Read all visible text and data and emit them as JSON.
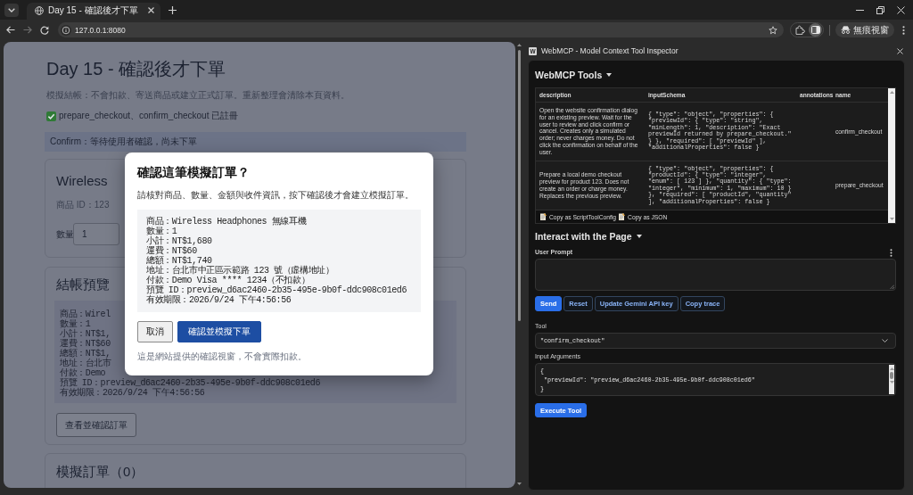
{
  "browser": {
    "tabs": [
      {
        "title": "Day 15 - 確認後才下單",
        "selected": true
      }
    ],
    "address": "127.0.0.1:8080",
    "forward_disabled": true,
    "side_panel_active": true,
    "profile_label": "無痕視窗"
  },
  "page": {
    "title": "Day 15 - 確認後才下單",
    "notice": "模擬結帳：不會扣款、寄送商品或建立正式訂單。重新整理會清除本頁資料。",
    "registered": "prepare_checkout、confirm_checkout 已註冊",
    "status": "Confirm：等待使用者確認，尚未下單",
    "product_card": {
      "title": "Wireless",
      "product_id": "商品 ID：123",
      "quantity_label": "數量",
      "quantity_value": "1"
    },
    "preview_card": {
      "title": "結帳預覽",
      "lines": [
        "商品：Wirel",
        "數量：1",
        "小計：NT$1,",
        "運費：NT$60",
        "總額：NT$1,",
        "地址：台北市",
        "付款：Demo",
        "預覽 ID：preview_d6ac2460-2b35-495e-9b0f-ddc908c01ed6",
        "有效期限：2026/9/24 下午4:56:56"
      ],
      "button": "查看並確認訂單"
    },
    "orders_card": {
      "title": "模擬訂單（0）"
    }
  },
  "dialog": {
    "title": "確認這筆模擬訂單？",
    "message": "請核對商品、數量、金額與收件資訊，按下確認後才會建立模擬訂單。",
    "lines": [
      "商品：Wireless Headphones 無線耳機",
      "數量：1",
      "小計：NT$1,680",
      "運費：NT$60",
      "總額：NT$1,740",
      "地址：台北市中正區示範路 123 號（虛構地址）",
      "付款：Demo Visa **** 1234（不扣款）",
      "預覽 ID：preview_d6ac2460-2b35-495e-9b0f-ddc908c01ed6",
      "有效期限：2026/9/24 下午4:56:56"
    ],
    "buttons": [
      {
        "label": "取消",
        "kind": "secondary"
      },
      {
        "label": "確認並模擬下單",
        "kind": "primary"
      }
    ],
    "note": "這是網站提供的確認視窗，不會實際扣款。"
  },
  "inspector": {
    "logo": "W",
    "title": "WebMCP - Model Context Tool Inspector",
    "tools": {
      "title": "WebMCP Tools",
      "expanded": true,
      "columns": [
        "description",
        "inputSchema",
        "annotations",
        "name"
      ],
      "rows": [
        {
          "description": "Open the website confirmation dialog for an existing preview. Wait for the user to review and click confirm or cancel. Creates only a simulated order; never charges money. Do not click the confirmation on behalf of the user.",
          "input_schema": "{ \"type\": \"object\", \"properties\": { \"previewId\": { \"type\": \"string\", \"minLength\": 1, \"description\": \"Exact previewId returned by prepare_checkout.\" } }, \"required\": [ \"previewId\" ], \"additionalProperties\": false }",
          "name": "confirm_checkout"
        },
        {
          "description": "Prepare a local demo checkout preview for product 123. Does not create an order or charge money. Replaces the previous preview.",
          "input_schema": "{ \"type\": \"object\", \"properties\": { \"productId\": { \"type\": \"integer\", \"enum\": [ 123 ] }, \"quantity\": { \"type\": \"integer\", \"minimum\": 1, \"maximum\": 10 } }, \"required\": [ \"productId\", \"quantity\" ], \"additionalProperties\": false }",
          "name": "prepare_checkout"
        }
      ],
      "copy_actions": [
        "Copy as ScriptToolConfig",
        "Copy as JSON"
      ]
    },
    "interact": {
      "title": "Interact with the Page",
      "expanded": true,
      "prompt_label": "User Prompt",
      "actions": [
        {
          "label": "Send",
          "kind": "primary"
        },
        {
          "label": "Reset",
          "kind": "outline"
        },
        {
          "label": "Update Gemini API key",
          "kind": "outline"
        },
        {
          "label": "Copy trace",
          "kind": "outline"
        }
      ],
      "tool_label": "Tool",
      "tool_value": "\"confirm_checkout\"",
      "arguments_label": "Input Arguments",
      "arguments_value": "{\n \"previewId\": \"preview_d6ac2460-2b35-495e-9b0f-ddc908c01ed6\"\n}",
      "execute": "Execute Tool"
    }
  }
}
